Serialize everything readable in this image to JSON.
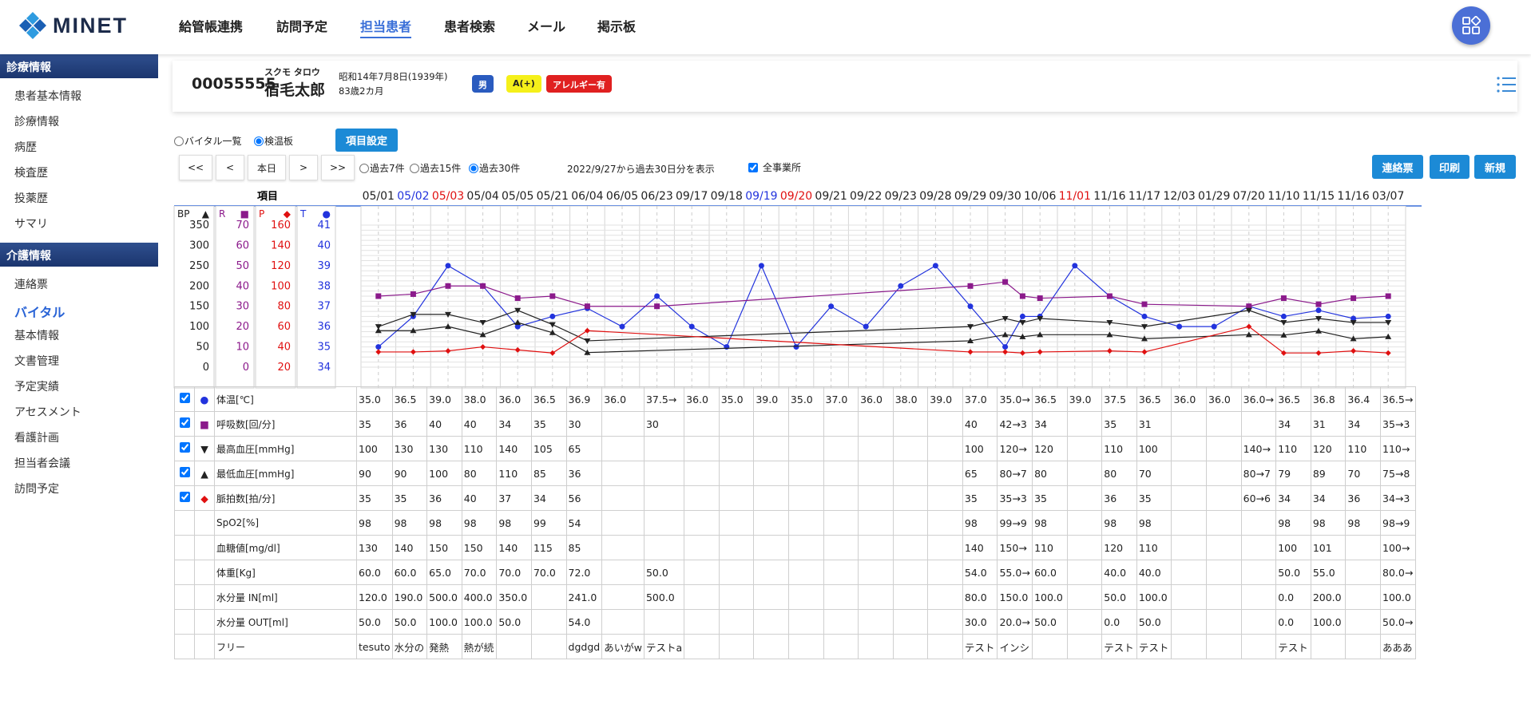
{
  "brand": {
    "name": "MINET",
    "color": "#1c2b4a",
    "accent": "#3a6fd8"
  },
  "nav": {
    "items": [
      "給管帳連携",
      "訪問予定",
      "担当患者",
      "患者検索",
      "メール",
      "掲示板"
    ],
    "active_index": 2,
    "apps_icon": "grid-apps-icon"
  },
  "sidebar": {
    "sections": [
      {
        "title": "診療情報",
        "items": [
          "患者基本情報",
          "診療情報",
          "病歴",
          "検査歴",
          "投薬歴",
          "サマリ"
        ]
      },
      {
        "title": "介護情報",
        "items": [
          "連絡票",
          "バイタル",
          "基本情報",
          "文書管理",
          "予定実績",
          "アセスメント",
          "看護計画",
          "担当者会議",
          "訪問予定"
        ]
      }
    ],
    "active_item": "バイタル"
  },
  "patient": {
    "id": "00055555",
    "kana": "スクモ タロウ",
    "name": "宿毛太郎",
    "birth": "昭和14年7月8日(1939年)",
    "age": "83歳2カ月",
    "badges": [
      {
        "label": "男",
        "bg": "#2a5bbf",
        "fg": "#ffffff"
      },
      {
        "label": "A(+)",
        "bg": "#f5f01a",
        "fg": "#222222"
      },
      {
        "label": "アレルギー有",
        "bg": "#e02020",
        "fg": "#ffffff"
      }
    ]
  },
  "controls": {
    "view_list": "バイタル一覧",
    "view_board": "検温板",
    "item_settings": "項目設定",
    "nav_first": "<<",
    "nav_prev": "<",
    "nav_today": "本日",
    "nav_next": ">",
    "nav_last": ">>",
    "range_7": "過去7件",
    "range_15": "過去15件",
    "range_30": "過去30件",
    "range_text": "2022/9/27から過去30日分を表示",
    "all_offices": "全事業所",
    "btn_contact": "連絡票",
    "btn_print": "印刷",
    "btn_new": "新規"
  },
  "chart_data": {
    "type": "line",
    "column_header": "項目",
    "dates": [
      "05/01",
      "05/02",
      "05/03",
      "05/04",
      "05/05",
      "05/21",
      "06/04",
      "06/05",
      "06/23",
      "09/17",
      "09/18",
      "09/19",
      "09/20",
      "09/21",
      "09/22",
      "09/23",
      "09/28",
      "09/29",
      "09/30",
      "10/06",
      "11/01",
      "11/16",
      "11/17",
      "12/03",
      "01/29",
      "07/20",
      "11/10",
      "11/15",
      "11/16",
      "03/07"
    ],
    "date_colors": [
      "#222",
      "#2233dd",
      "#e01010",
      "#222",
      "#222",
      "#222",
      "#222",
      "#222",
      "#222",
      "#222",
      "#222",
      "#2233dd",
      "#e01010",
      "#222",
      "#222",
      "#222",
      "#222",
      "#222",
      "#222",
      "#222",
      "#e01010",
      "#222",
      "#222",
      "#222",
      "#222",
      "#222",
      "#222",
      "#222",
      "#222",
      "#222"
    ],
    "axes": [
      {
        "label": "BP",
        "marker": "▲",
        "color": "#222222",
        "ticks": [
          "350",
          "300",
          "250",
          "200",
          "150",
          "100",
          "50",
          "0"
        ]
      },
      {
        "label": "R",
        "marker": "■",
        "color": "#8b1a8b",
        "ticks": [
          "70",
          "60",
          "50",
          "40",
          "30",
          "20",
          "10",
          "0"
        ]
      },
      {
        "label": "P",
        "marker": "◆",
        "color": "#e01010",
        "ticks": [
          "160",
          "140",
          "120",
          "100",
          "80",
          "60",
          "40",
          "20"
        ]
      },
      {
        "label": "T",
        "marker": "●",
        "color": "#2233dd",
        "ticks": [
          "41",
          "40",
          "39",
          "38",
          "37",
          "36",
          "35",
          "34"
        ]
      }
    ],
    "series": [
      {
        "name": "体温[℃]",
        "color": "#2233dd",
        "marker": "circle",
        "axis_min": 34,
        "axis_max": 41,
        "points": [
          [
            0,
            35.0
          ],
          [
            1,
            36.5
          ],
          [
            2,
            39.0
          ],
          [
            3,
            38.0
          ],
          [
            4,
            36.0
          ],
          [
            5,
            36.5
          ],
          [
            6,
            36.9
          ],
          [
            7,
            36.0
          ],
          [
            8,
            37.5
          ],
          [
            9,
            36.0
          ],
          [
            10,
            35.0
          ],
          [
            11,
            39.0
          ],
          [
            12,
            35.0
          ],
          [
            13,
            37.0
          ],
          [
            14,
            36.0
          ],
          [
            15,
            38.0
          ],
          [
            16,
            39.0
          ],
          [
            17,
            37.0
          ],
          [
            18,
            35.0
          ],
          [
            18.5,
            36.5
          ],
          [
            19,
            36.5
          ],
          [
            20,
            39.0
          ],
          [
            21,
            37.5
          ],
          [
            22,
            36.5
          ],
          [
            23,
            36.0
          ],
          [
            24,
            36.0
          ],
          [
            25,
            37.0
          ],
          [
            26,
            36.5
          ],
          [
            27,
            36.8
          ],
          [
            28,
            36.4
          ],
          [
            29,
            36.5
          ]
        ]
      },
      {
        "name": "呼吸数[回/分]",
        "color": "#8b1a8b",
        "marker": "square",
        "axis_min": 0,
        "axis_max": 70,
        "points": [
          [
            0,
            35
          ],
          [
            1,
            36
          ],
          [
            2,
            40
          ],
          [
            3,
            40
          ],
          [
            4,
            34
          ],
          [
            5,
            35
          ],
          [
            6,
            30
          ],
          [
            8,
            30
          ],
          [
            17,
            40
          ],
          [
            18,
            42
          ],
          [
            18.5,
            35
          ],
          [
            19,
            34
          ],
          [
            21,
            35
          ],
          [
            22,
            31
          ],
          [
            25,
            30
          ],
          [
            26,
            34
          ],
          [
            27,
            31
          ],
          [
            28,
            34
          ],
          [
            29,
            35
          ]
        ]
      },
      {
        "name": "最高血圧[mmHg]",
        "color": "#222222",
        "marker": "triangle-down",
        "axis_min": 0,
        "axis_max": 350,
        "points": [
          [
            0,
            100
          ],
          [
            1,
            130
          ],
          [
            2,
            130
          ],
          [
            3,
            110
          ],
          [
            4,
            140
          ],
          [
            5,
            105
          ],
          [
            6,
            65
          ],
          [
            17,
            100
          ],
          [
            18,
            120
          ],
          [
            18.5,
            110
          ],
          [
            19,
            120
          ],
          [
            21,
            110
          ],
          [
            22,
            100
          ],
          [
            25,
            140
          ],
          [
            26,
            110
          ],
          [
            27,
            120
          ],
          [
            28,
            110
          ],
          [
            29,
            110
          ]
        ]
      },
      {
        "name": "最低血圧[mmHg]",
        "color": "#222222",
        "marker": "triangle-up",
        "axis_min": 0,
        "axis_max": 350,
        "points": [
          [
            0,
            90
          ],
          [
            1,
            90
          ],
          [
            2,
            100
          ],
          [
            3,
            80
          ],
          [
            4,
            110
          ],
          [
            5,
            85
          ],
          [
            6,
            36
          ],
          [
            17,
            65
          ],
          [
            18,
            80
          ],
          [
            18.5,
            75
          ],
          [
            19,
            80
          ],
          [
            21,
            80
          ],
          [
            22,
            70
          ],
          [
            25,
            80
          ],
          [
            26,
            79
          ],
          [
            27,
            89
          ],
          [
            28,
            70
          ],
          [
            29,
            75
          ]
        ]
      },
      {
        "name": "脈拍数[拍/分]",
        "color": "#e01010",
        "marker": "diamond",
        "axis_min": 20,
        "axis_max": 160,
        "points": [
          [
            0,
            35
          ],
          [
            1,
            35
          ],
          [
            2,
            36
          ],
          [
            3,
            40
          ],
          [
            4,
            37
          ],
          [
            5,
            34
          ],
          [
            6,
            56
          ],
          [
            17,
            35
          ],
          [
            18,
            35
          ],
          [
            18.5,
            34
          ],
          [
            19,
            35
          ],
          [
            21,
            36
          ],
          [
            22,
            35
          ],
          [
            25,
            60
          ],
          [
            26,
            34
          ],
          [
            27,
            34
          ],
          [
            28,
            36
          ],
          [
            29,
            34
          ]
        ]
      }
    ]
  },
  "table": {
    "rows": [
      {
        "checked": true,
        "marker": "●",
        "marker_color": "#2233dd",
        "label": "体温[℃]",
        "cells": [
          "35.0",
          "36.5",
          "39.0",
          "38.0",
          "36.0",
          "36.5",
          "36.9",
          "36.0",
          "37.5→",
          "36.0",
          "35.0",
          "39.0",
          "35.0",
          "37.0",
          "36.0",
          "38.0",
          "39.0",
          "37.0",
          "35.0→",
          "36.5",
          "39.0",
          "37.5",
          "36.5",
          "36.0",
          "36.0",
          "36.0→",
          "36.5",
          "36.8",
          "36.4",
          "36.5→"
        ]
      },
      {
        "checked": true,
        "marker": "■",
        "marker_color": "#8b1a8b",
        "label": "呼吸数[回/分]",
        "cells": [
          "35",
          "36",
          "40",
          "40",
          "34",
          "35",
          "30",
          "",
          "30",
          "",
          "",
          "",
          "",
          "",
          "",
          "",
          "",
          "40",
          "42→3",
          "34",
          "",
          "35",
          "31",
          "",
          "",
          "",
          "34",
          "31",
          "34",
          "35→3"
        ]
      },
      {
        "checked": true,
        "marker": "▼",
        "marker_color": "#222222",
        "label": "最高血圧[mmHg]",
        "cells": [
          "100",
          "130",
          "130",
          "110",
          "140",
          "105",
          "65",
          "",
          "",
          "",
          "",
          "",
          "",
          "",
          "",
          "",
          "",
          "100",
          "120→",
          "120",
          "",
          "110",
          "100",
          "",
          "",
          "140→",
          "110",
          "120",
          "110",
          "110→"
        ]
      },
      {
        "checked": true,
        "marker": "▲",
        "marker_color": "#222222",
        "label": "最低血圧[mmHg]",
        "cells": [
          "90",
          "90",
          "100",
          "80",
          "110",
          "85",
          "36",
          "",
          "",
          "",
          "",
          "",
          "",
          "",
          "",
          "",
          "",
          "65",
          "80→7",
          "80",
          "",
          "80",
          "70",
          "",
          "",
          "80→7",
          "79",
          "89",
          "70",
          "75→8"
        ]
      },
      {
        "checked": true,
        "marker": "◆",
        "marker_color": "#e01010",
        "label": "脈拍数[拍/分]",
        "cells": [
          "35",
          "35",
          "36",
          "40",
          "37",
          "34",
          "56",
          "",
          "",
          "",
          "",
          "",
          "",
          "",
          "",
          "",
          "",
          "35",
          "35→3",
          "35",
          "",
          "36",
          "35",
          "",
          "",
          "60→6",
          "34",
          "34",
          "36",
          "34→3"
        ]
      },
      {
        "checked": false,
        "marker": "",
        "marker_color": "#222222",
        "label": "SpO2[%]",
        "cells": [
          "98",
          "98",
          "98",
          "98",
          "98",
          "99",
          "54",
          "",
          "",
          "",
          "",
          "",
          "",
          "",
          "",
          "",
          "",
          "98",
          "99→9",
          "98",
          "",
          "98",
          "98",
          "",
          "",
          "",
          "98",
          "98",
          "98",
          "98→9"
        ]
      },
      {
        "checked": false,
        "marker": "",
        "marker_color": "#222222",
        "label": "血糖値[mg/dl]",
        "cells": [
          "130",
          "140",
          "150",
          "150",
          "140",
          "115",
          "85",
          "",
          "",
          "",
          "",
          "",
          "",
          "",
          "",
          "",
          "",
          "140",
          "150→",
          "110",
          "",
          "120",
          "110",
          "",
          "",
          "",
          "100",
          "101",
          "",
          "100→"
        ]
      },
      {
        "checked": false,
        "marker": "",
        "marker_color": "#222222",
        "label": "体重[Kg]",
        "cells": [
          "60.0",
          "60.0",
          "65.0",
          "70.0",
          "70.0",
          "70.0",
          "72.0",
          "",
          "50.0",
          "",
          "",
          "",
          "",
          "",
          "",
          "",
          "",
          "54.0",
          "55.0→",
          "60.0",
          "",
          "40.0",
          "40.0",
          "",
          "",
          "",
          "50.0",
          "55.0",
          "",
          "80.0→"
        ]
      },
      {
        "checked": false,
        "marker": "",
        "marker_color": "#222222",
        "label": "水分量 IN[ml]",
        "cells": [
          "120.0",
          "190.0",
          "500.0",
          "400.0",
          "350.0",
          "",
          "241.0",
          "",
          "500.0",
          "",
          "",
          "",
          "",
          "",
          "",
          "",
          "",
          "80.0",
          "150.0",
          "100.0",
          "",
          "50.0",
          "100.0",
          "",
          "",
          "",
          "0.0",
          "200.0",
          "",
          "100.0"
        ]
      },
      {
        "checked": false,
        "marker": "",
        "marker_color": "#222222",
        "label": "水分量 OUT[ml]",
        "cells": [
          "50.0",
          "50.0",
          "100.0",
          "100.0",
          "50.0",
          "",
          "54.0",
          "",
          "",
          "",
          "",
          "",
          "",
          "",
          "",
          "",
          "",
          "30.0",
          "20.0→",
          "50.0",
          "",
          "0.0",
          "50.0",
          "",
          "",
          "",
          "0.0",
          "100.0",
          "",
          "50.0→"
        ]
      },
      {
        "checked": false,
        "marker": "",
        "marker_color": "#222222",
        "label": "フリー",
        "cells": [
          "tesuto",
          "水分の",
          "発熱",
          "熱が続",
          "",
          "",
          "dgdgd",
          "あいがw",
          "テストa",
          "",
          "",
          "",
          "",
          "",
          "",
          "",
          "",
          "テスト",
          "インシ",
          "",
          "",
          "テスト",
          "テスト",
          "",
          "",
          "",
          "テスト",
          "",
          "",
          "あああ"
        ]
      }
    ]
  }
}
